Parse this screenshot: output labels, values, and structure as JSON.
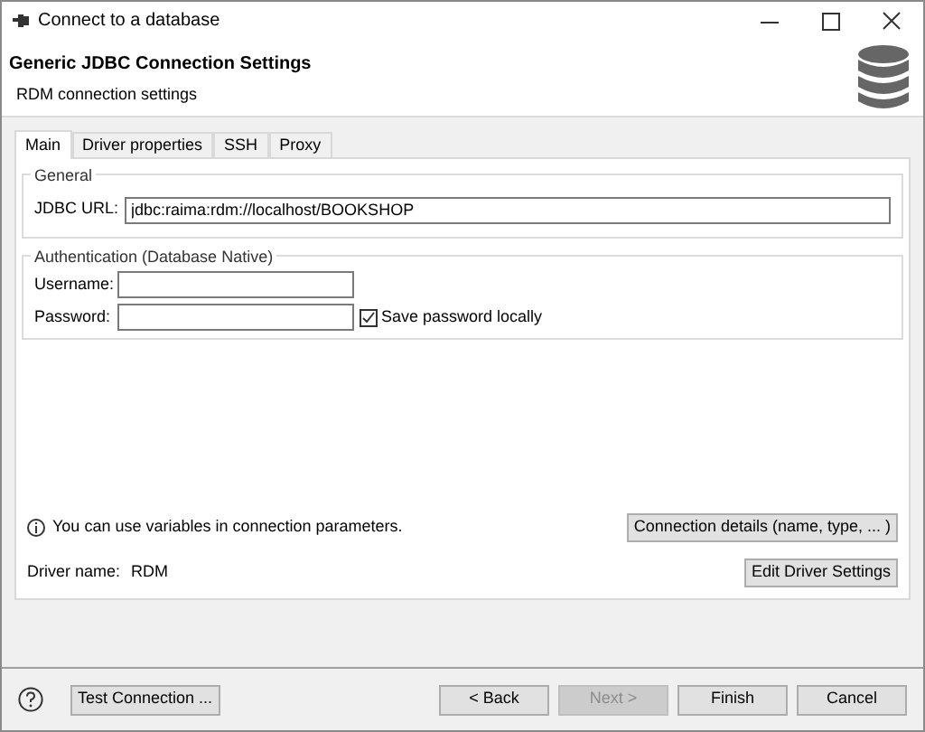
{
  "window": {
    "title": "Connect to a database"
  },
  "header": {
    "title": "Generic JDBC Connection Settings",
    "subtitle": "RDM connection settings"
  },
  "tabs": [
    {
      "label": "Main",
      "selected": true
    },
    {
      "label": "Driver properties",
      "selected": false
    },
    {
      "label": "SSH",
      "selected": false
    },
    {
      "label": "Proxy",
      "selected": false
    }
  ],
  "general": {
    "legend": "General",
    "url_label": "JDBC URL:",
    "url_value": "jdbc:raima:rdm://localhost/BOOKSHOP"
  },
  "auth": {
    "legend": "Authentication (Database Native)",
    "username_label": "Username:",
    "password_label": "Password:",
    "save_password": {
      "label": "Save password locally",
      "checked": true
    }
  },
  "info": "You can use variables in connection parameters.",
  "connection_details_button": "Connection details (name, type, ... )",
  "driver": {
    "label": "Driver name:",
    "value": "RDM"
  },
  "edit_driver_button": "Edit Driver Settings",
  "footer_buttons": [
    {
      "label": "Test Connection ...",
      "kind": "test",
      "disabled": false
    },
    {
      "label": "< Back",
      "kind": "nav",
      "disabled": false
    },
    {
      "label": "Next >",
      "kind": "nav",
      "disabled": true
    },
    {
      "label": "Finish",
      "kind": "nav",
      "disabled": false
    },
    {
      "label": "Cancel",
      "kind": "nav",
      "disabled": false
    }
  ]
}
